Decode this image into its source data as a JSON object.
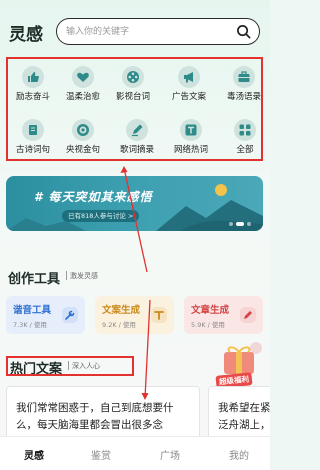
{
  "header": {
    "app_title": "灵感",
    "search_placeholder": "输入你的关键字"
  },
  "categories": [
    {
      "label": "励志奋斗",
      "icon": "thumbs-up-icon"
    },
    {
      "label": "温柔治愈",
      "icon": "heart-hands-icon"
    },
    {
      "label": "影视台词",
      "icon": "film-reel-icon"
    },
    {
      "label": "广告文案",
      "icon": "megaphone-icon"
    },
    {
      "label": "毒汤语录",
      "icon": "toolbox-icon"
    },
    {
      "label": "古诗词句",
      "icon": "scroll-icon"
    },
    {
      "label": "央视金句",
      "icon": "target-icon"
    },
    {
      "label": "歌词摘录",
      "icon": "pen-icon"
    },
    {
      "label": "网络热词",
      "icon": "trending-t-icon"
    },
    {
      "label": "全部",
      "icon": "grid-icon"
    }
  ],
  "banner": {
    "title": "# 每天突如其来感悟",
    "badge": "已有818人参与讨论 >"
  },
  "creative_tools": {
    "title": "创作工具",
    "subtitle": "激发灵感",
    "items": [
      {
        "name": "谐音工具",
        "meta": "7.3K / 使用",
        "color": "#2f6fd1",
        "bg": "#e6eefb"
      },
      {
        "name": "文案生成",
        "meta": "9.2K / 使用",
        "color": "#c98a1c",
        "bg": "#fbf1df"
      },
      {
        "name": "文章生成",
        "meta": "5.9K / 使用",
        "color": "#d24545",
        "bg": "#fbe6e6"
      }
    ]
  },
  "hot_copy": {
    "title": "热门文案",
    "subtitle": "深入人心",
    "promo_label": "超级福利",
    "articles": [
      {
        "line1": "我们常常困惑于，自己到底想要什",
        "line2": "么，每天脑海里都会冒出很多念"
      },
      {
        "line1": "我希望在紧华结",
        "line2": "泛舟湖上，日三"
      }
    ]
  },
  "tabbar": [
    {
      "label": "灵感",
      "active": true
    },
    {
      "label": "鉴赏",
      "active": false
    },
    {
      "label": "广场",
      "active": false
    },
    {
      "label": "我的",
      "active": false
    }
  ],
  "colors": {
    "annotation_red": "#e3312f",
    "icon_teal": "#2e8b8a"
  }
}
